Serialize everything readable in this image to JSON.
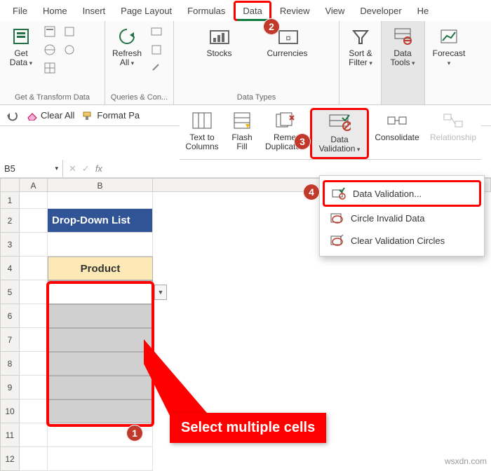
{
  "menu": {
    "file": "File",
    "home": "Home",
    "insert": "Insert",
    "pagelayout": "Page Layout",
    "formulas": "Formulas",
    "data": "Data",
    "review": "Review",
    "view": "View",
    "developer": "Developer",
    "help": "He"
  },
  "ribbon": {
    "group1": {
      "getdata": "Get\nData",
      "label": "Get & Transform Data"
    },
    "group2": {
      "refresh": "Refresh\nAll",
      "label": "Queries & Con..."
    },
    "group3": {
      "stocks": "Stocks",
      "currencies": "Currencies",
      "label": "Data Types"
    },
    "group4": {
      "sortfilter": "Sort &\nFilter"
    },
    "group5": {
      "datatools": "Data\nTools"
    },
    "group6": {
      "forecast": "Forecast"
    }
  },
  "secbar": {
    "clearall": "Clear All",
    "formatpa": "Format Pa"
  },
  "tools": {
    "textcols": "Text to\nColumns",
    "flashfill": "Flash\nFill",
    "remdup": "Reme\nDuplicates",
    "datavalidation": "Data\nValidation",
    "consolidate": "Consolidate",
    "relationship": "Relationship"
  },
  "popup": {
    "dv": "Data Validation...",
    "circle": "Circle Invalid Data",
    "clear": "Clear Validation Circles"
  },
  "formula": {
    "namebox": "B5",
    "fx": "fx"
  },
  "sheet": {
    "colA": "A",
    "colB": "B",
    "rows": [
      "1",
      "2",
      "3",
      "4",
      "5",
      "6",
      "7",
      "8",
      "9",
      "10",
      "11",
      "12"
    ],
    "title": "Drop-Down List",
    "header": "Product"
  },
  "callout": {
    "text": "Select multiple cells"
  },
  "badges": {
    "b1": "1",
    "b2": "2",
    "b3": "3",
    "b4": "4"
  },
  "watermark": "wsxdn.com"
}
